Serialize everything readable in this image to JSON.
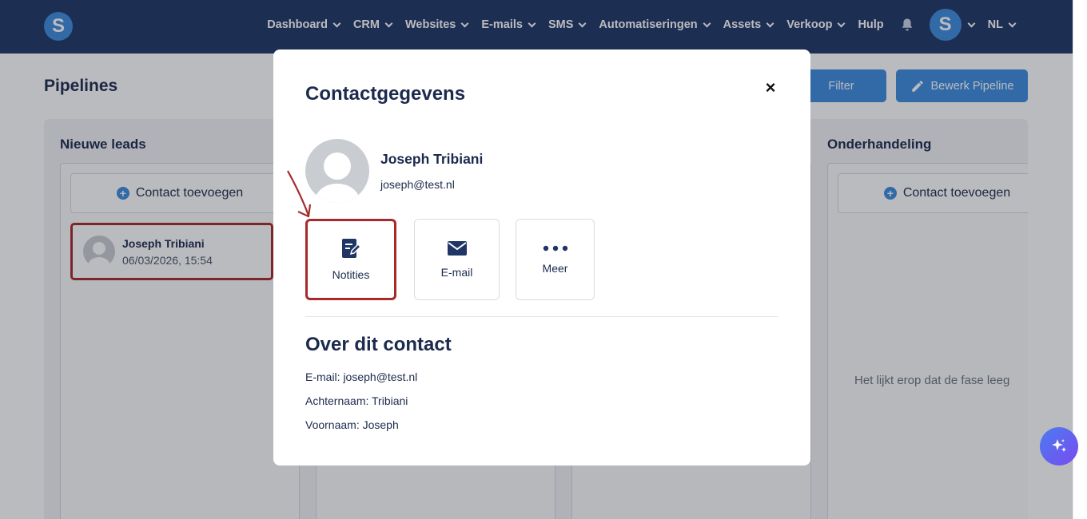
{
  "nav": {
    "logo_letter": "S",
    "items": [
      {
        "label": "Dashboard"
      },
      {
        "label": "CRM"
      },
      {
        "label": "Websites"
      },
      {
        "label": "E-mails"
      },
      {
        "label": "SMS"
      },
      {
        "label": "Automatiseringen"
      },
      {
        "label": "Assets"
      },
      {
        "label": "Verkoop"
      }
    ],
    "help_label": "Hulp",
    "avatar_letter": "S",
    "language": "NL"
  },
  "page": {
    "title": "Pipelines",
    "filter_label": "Filter",
    "edit_label": "Bewerk Pipeline"
  },
  "board": {
    "columns": [
      {
        "title": "Nieuwe leads",
        "add_label": "Contact toevoegen"
      },
      {
        "title": "Onderhandeling",
        "add_label": "Contact toevoegen",
        "empty_text": "Het lijkt erop dat de fase leeg"
      }
    ],
    "lead": {
      "name": "Joseph Tribiani",
      "date": "06/03/2026, 15:54"
    }
  },
  "modal": {
    "title": "Contactgegevens",
    "close": "×",
    "contact": {
      "name": "Joseph Tribiani",
      "email": "joseph@test.nl"
    },
    "actions": {
      "notes": "Notities",
      "email": "E-mail",
      "more": "Meer"
    },
    "about": {
      "title": "Over dit contact",
      "email_line": "E-mail: joseph@test.nl",
      "lastname_line": "Achternaam: Tribiani",
      "firstname_line": "Voornaam: Joseph"
    }
  },
  "colors": {
    "navbar": "#1f3566",
    "accent": "#3d8be0",
    "highlight": "#a62a2a"
  }
}
